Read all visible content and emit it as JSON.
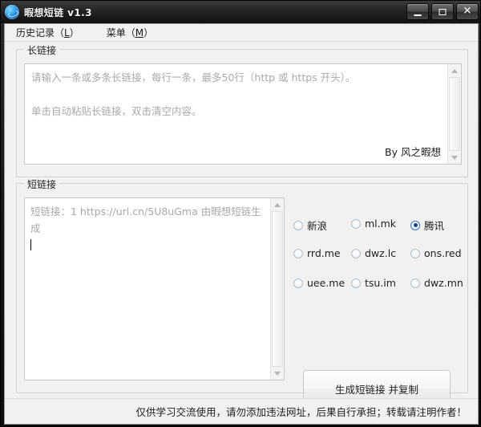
{
  "window": {
    "title": "暇想短链 v1.3",
    "icon": "app-swirl-icon",
    "controls": {
      "minimize": "—",
      "maximize": "□",
      "close": "✕"
    }
  },
  "menubar": {
    "items": [
      {
        "label": "历史记录（L）",
        "text": "历史记录（",
        "mnemonic": "L",
        "tail": "）"
      },
      {
        "label": "菜单（M）",
        "text": "菜单（",
        "mnemonic": "M",
        "tail": "）"
      }
    ]
  },
  "long_link": {
    "group_title": "长链接",
    "placeholder_line1": "请输入一条或多条长链接，每行一条，最多50行（http 或 https 开头）。",
    "placeholder_line2": "单击自动粘贴长链接，双击清空内容。",
    "byline": "By 风之暇想"
  },
  "short_link": {
    "group_title": "短链接",
    "placeholder": "短链接：1   https://url.cn/5U8uGma   由暇想短链生成",
    "value": ""
  },
  "providers": {
    "selected": "腾讯",
    "options": [
      {
        "label": "新浪",
        "checked": false
      },
      {
        "label": "ml.mk",
        "checked": false
      },
      {
        "label": "腾讯",
        "checked": true
      },
      {
        "label": "rrd.me",
        "checked": false
      },
      {
        "label": "dwz.lc",
        "checked": false
      },
      {
        "label": "ons.red",
        "checked": false
      },
      {
        "label": "uee.me",
        "checked": false
      },
      {
        "label": "tsu.im",
        "checked": false
      },
      {
        "label": "dwz.mn",
        "checked": false
      }
    ]
  },
  "actions": {
    "generate_label": "生成短链接 并复制"
  },
  "status": {
    "text": "仅供学习交流使用，请勿添加违法网址，后果自行承担；转载请注明作者！"
  },
  "colors": {
    "titlebar": "#242424",
    "client_bg": "#f1f1f1",
    "accent_radio": "#15457f",
    "text": "#1f1f1f",
    "placeholder": "#a9a9a9"
  }
}
